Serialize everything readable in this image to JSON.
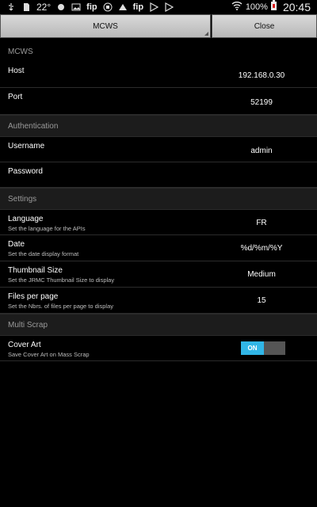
{
  "status": {
    "temperature": "22°",
    "fip_1": "fip",
    "fip_2": "fip",
    "battery_pct": "100%",
    "time": "20:45"
  },
  "topbar": {
    "mcws_label": "MCWS",
    "close_label": "Close"
  },
  "sections": {
    "mcws": {
      "header": "MCWS",
      "host": {
        "label": "Host",
        "value": "192.168.0.30"
      },
      "port": {
        "label": "Port",
        "value": "52199"
      }
    },
    "authentication": {
      "header": "Authentication",
      "username": {
        "label": "Username",
        "value": "admin"
      },
      "password": {
        "label": "Password",
        "value": ""
      }
    },
    "settings": {
      "header": "Settings",
      "language": {
        "label": "Language",
        "sub": "Set the language for the APIs",
        "value": "FR"
      },
      "date": {
        "label": "Date",
        "sub": "Set the date display format",
        "value": "%d/%m/%Y"
      },
      "thumbnail": {
        "label": "Thumbnail Size",
        "sub": "Set the JRMC Thumbnail Size to display",
        "value": "Medium"
      },
      "files_per_page": {
        "label": "Files per page",
        "sub": "Set the Nbrs. of files per page to display",
        "value": "15"
      }
    },
    "multiscrap": {
      "header": "Multi Scrap",
      "cover_art": {
        "label": "Cover Art",
        "sub": "Save Cover Art on Mass Scrap",
        "toggle_on_label": "ON"
      }
    }
  },
  "colors": {
    "toggle_on": "#31b6e7",
    "background": "#000000",
    "section_header_bg": "#1c1c1c"
  }
}
